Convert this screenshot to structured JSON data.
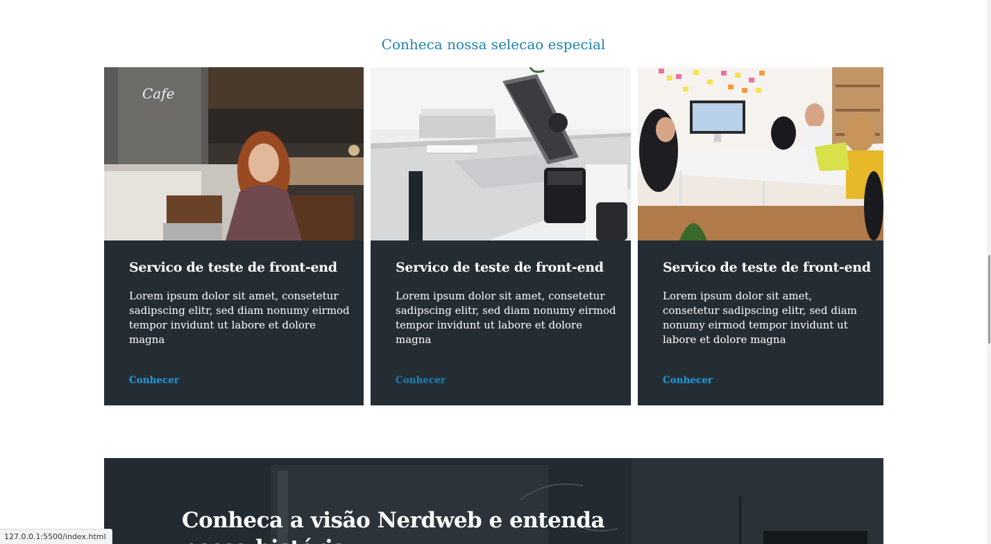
{
  "section": {
    "title": "Conheca nossa selecao especial"
  },
  "cards": [
    {
      "image": "woman-laptop-cafe-photo",
      "title": "Servico de teste de front-end",
      "text": "Lorem ipsum dolor sit amet, consetetur sadipscing elitr, sed diam nonumy eirmod tempor invidunt ut labore et dolore magna",
      "link": "Conhecer"
    },
    {
      "image": "laptop-desk-photo",
      "title": "Servico de teste de front-end",
      "text": "Lorem ipsum dolor sit amet, consetetur sadipscing elitr, sed diam nonumy eirmod tempor invidunt ut labore et dolore magna",
      "link": "Conhecer"
    },
    {
      "image": "team-meeting-photo",
      "title": "Servico de teste de front-end",
      "text": "Lorem ipsum dolor sit amet, consetetur sadipscing elitr, sed diam nonumy eirmod tempor invidunt ut labore et dolore magna",
      "link": "Conhecer"
    }
  ],
  "banner": {
    "title": "Conheca a visão Nerdweb e entenda nossa história"
  },
  "status_bar": {
    "url": "127.0.0.1:5500/index.html"
  },
  "colors": {
    "accent": "#1e82b4",
    "link": "#1a9be0",
    "card_bg": "#252d34",
    "banner_bg": "#242b32"
  }
}
